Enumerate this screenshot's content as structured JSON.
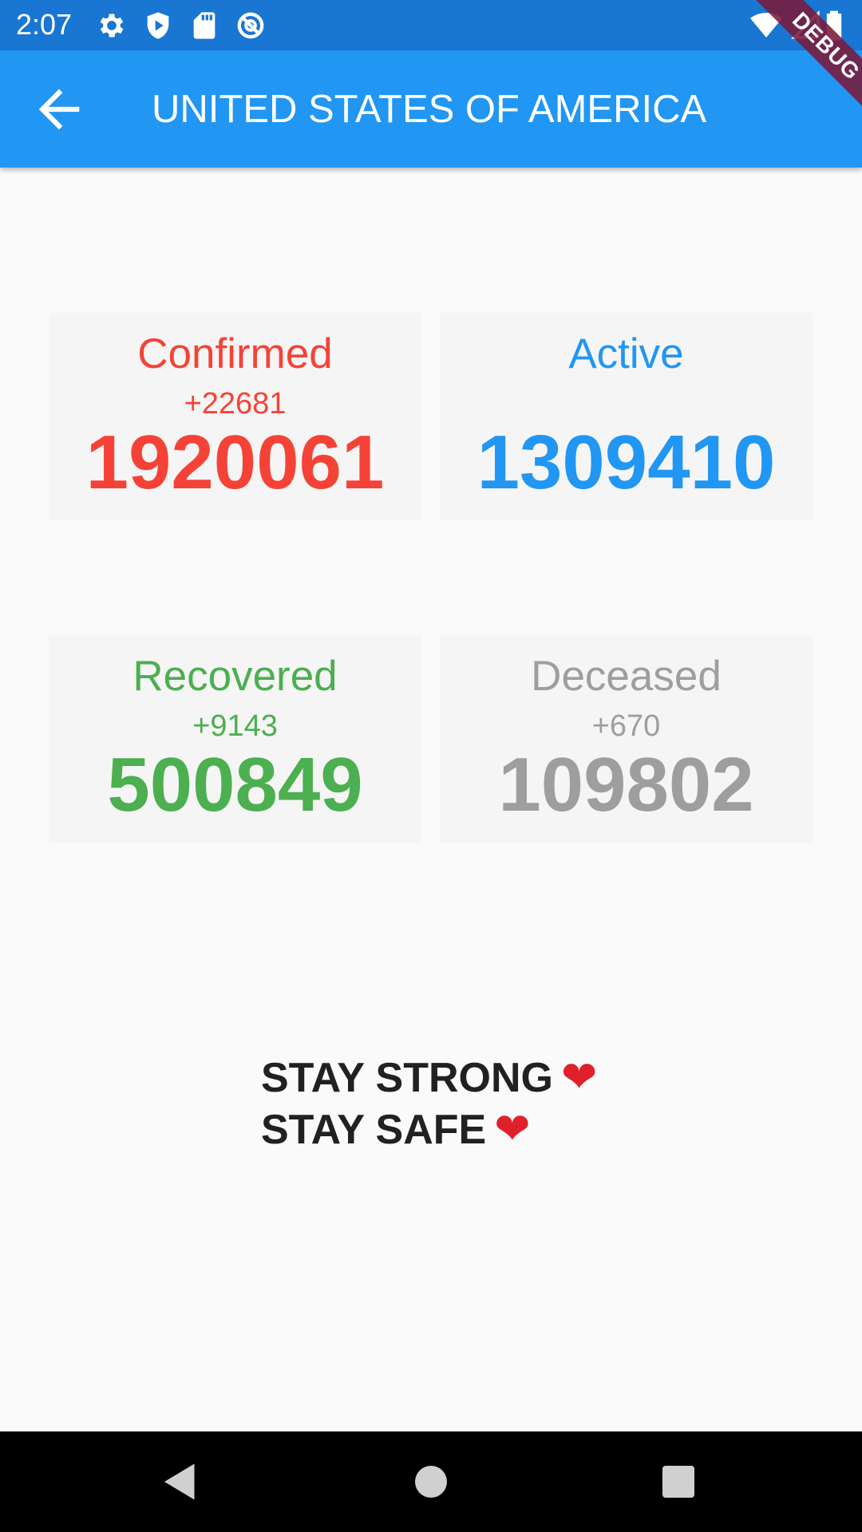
{
  "status_bar": {
    "time": "2:07",
    "left_icons": [
      "gear-icon",
      "shield-play-icon",
      "sd-card-icon",
      "no-sync-icon"
    ],
    "right_icons": [
      "wifi-icon",
      "cell-signal-icon",
      "battery-icon"
    ]
  },
  "app_bar": {
    "title": "UNITED STATES OF AMERICA",
    "back_icon": "arrow-back-icon"
  },
  "debug_banner": "DEBUG",
  "stats": {
    "confirmed": {
      "label": "Confirmed",
      "delta": "+22681",
      "value": "1920061",
      "color": "#f44336"
    },
    "active": {
      "label": "Active",
      "delta": "",
      "value": "1309410",
      "color": "#2196f3"
    },
    "recovered": {
      "label": "Recovered",
      "delta": "+9143",
      "value": "500849",
      "color": "#4caf50"
    },
    "deceased": {
      "label": "Deceased",
      "delta": "+670",
      "value": "109802",
      "color": "#9e9e9e"
    }
  },
  "motto": {
    "line1": "STAY STRONG",
    "line2": "STAY SAFE",
    "heart": "❤"
  },
  "nav_bar": {
    "buttons": [
      "back-triangle-icon",
      "home-circle-icon",
      "recents-square-icon"
    ]
  },
  "colors": {
    "status_bar": "#1976d2",
    "app_bar": "#2196f3",
    "background": "#fafafa",
    "card": "#f5f5f5"
  }
}
